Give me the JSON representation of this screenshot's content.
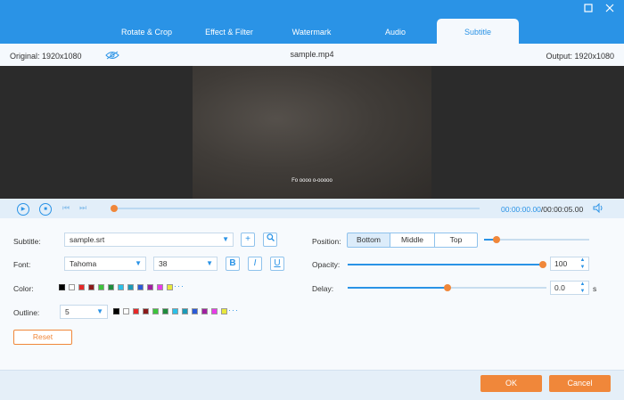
{
  "window": {
    "tabs": [
      "Rotate & Crop",
      "Effect & Filter",
      "Watermark",
      "Audio",
      "Subtitle"
    ],
    "active_tab": "Subtitle",
    "minimize_icon": "restore-icon",
    "close_icon": "close-icon"
  },
  "info": {
    "original": "Original: 1920x1080",
    "filename": "sample.mp4",
    "output": "Output: 1920x1080"
  },
  "preview": {
    "subtitle_text": "Fo oooo o-ooooo"
  },
  "playback": {
    "current": "00:00:00.00",
    "total": "/00:00:05.00",
    "progress": 0.0
  },
  "form": {
    "subtitle_label": "Subtitle:",
    "subtitle_file": "sample.srt",
    "font_label": "Font:",
    "font_name": "Tahoma",
    "font_size": "38",
    "bold": "B",
    "italic": "I",
    "underline": "U",
    "color_label": "Color:",
    "outline_label": "Outline:",
    "outline_value": "5",
    "more": "···",
    "position_label": "Position:",
    "positions": [
      "Bottom",
      "Middle",
      "Top"
    ],
    "active_position": "Bottom",
    "position_level": 0.12,
    "opacity_label": "Opacity:",
    "opacity_value": "100",
    "opacity_level": 1.0,
    "delay_label": "Delay:",
    "delay_value": "0.0",
    "delay_unit": "s",
    "delay_level": 0.5,
    "reset": "Reset"
  },
  "swatches": [
    "#000000",
    "#ffffff",
    "#e62828",
    "#8b1a1a",
    "#3cc43c",
    "#1e8c3c",
    "#2ac0e8",
    "#1a9ab8",
    "#2a5ad8",
    "#a020a0",
    "#e83ce8",
    "#e8e83c"
  ],
  "footer": {
    "ok": "OK",
    "cancel": "Cancel"
  },
  "colors": {
    "accent": "#2a93e6",
    "orange": "#f0873a"
  }
}
